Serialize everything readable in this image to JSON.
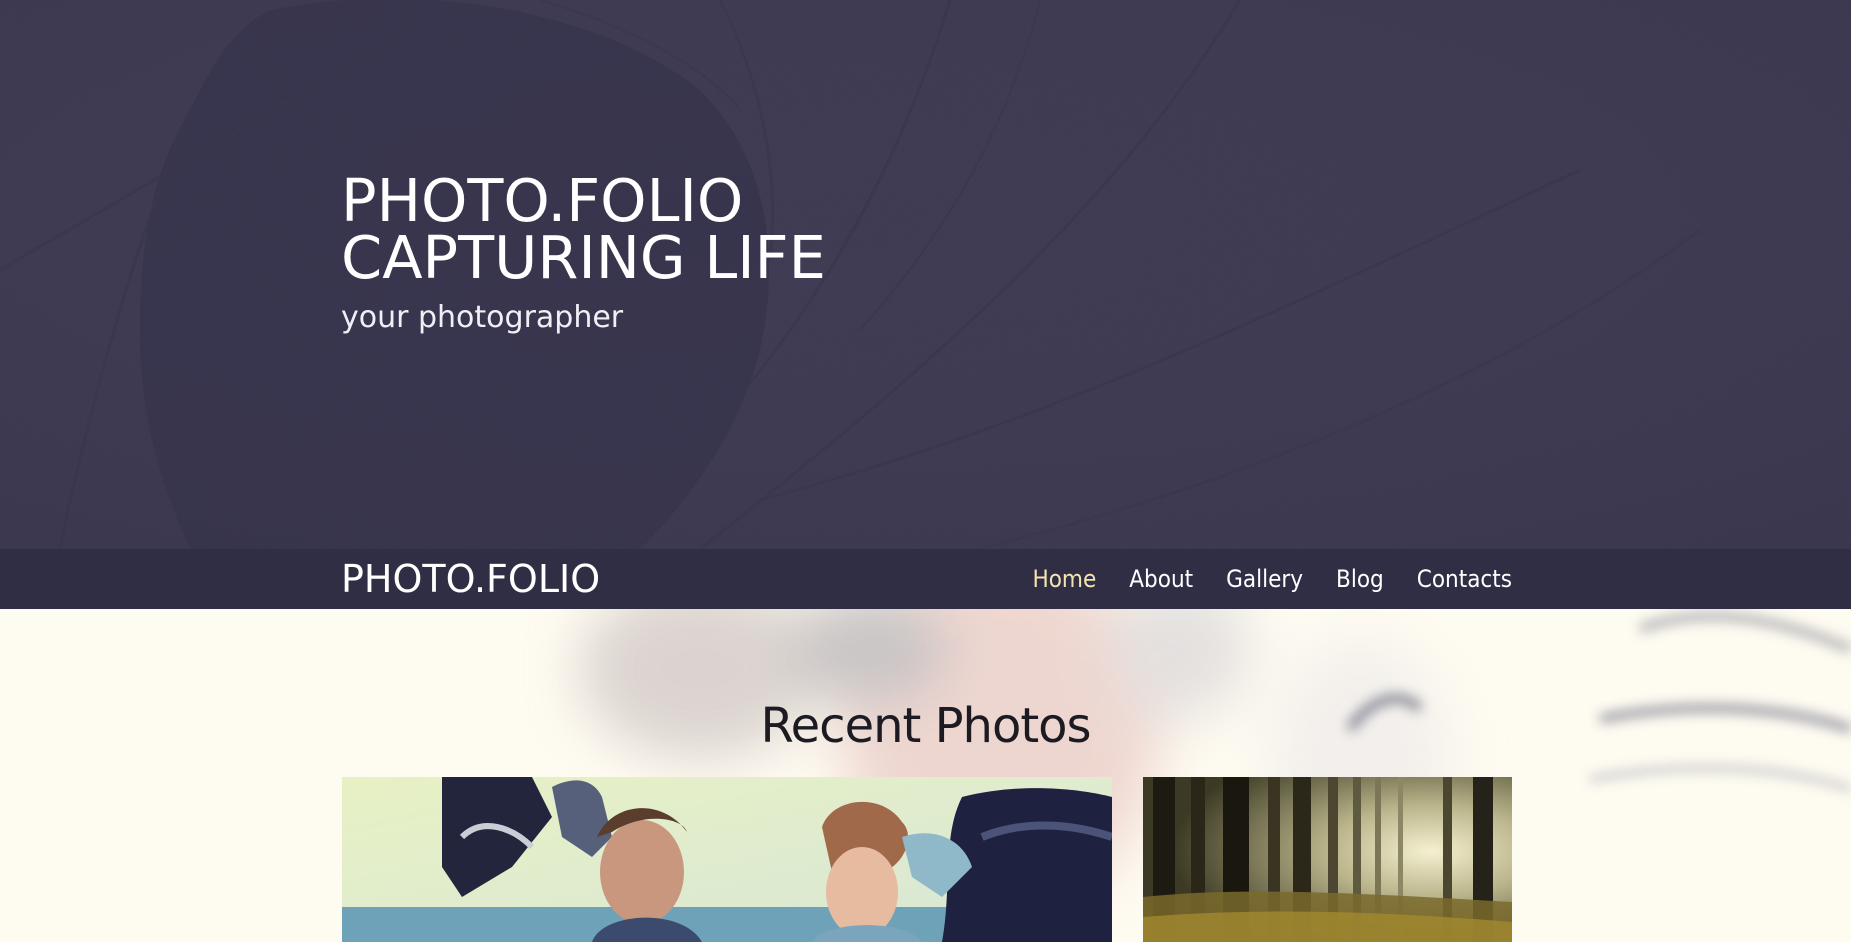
{
  "hero": {
    "title_line1": "PHOTO.FOLIO",
    "title_line2": "CAPTURING LIFE",
    "subtitle": "your photographer",
    "background_icon": "camera-aperture-icon"
  },
  "navbar": {
    "brand": "PHOTO.FOLIO",
    "links": [
      {
        "label": "Home",
        "active": true
      },
      {
        "label": "About",
        "active": false
      },
      {
        "label": "Gallery",
        "active": false
      },
      {
        "label": "Blog",
        "active": false
      },
      {
        "label": "Contacts",
        "active": false
      }
    ]
  },
  "main": {
    "section_title": "Recent Photos",
    "photos": [
      {
        "subject": "couple-motorcycle-photo"
      },
      {
        "subject": "forest-sunlight-photo"
      }
    ]
  },
  "colors": {
    "hero_bg": "#3e3b52",
    "navbar_bg": "#302e45",
    "active_link": "#f3e4b0",
    "content_bg": "#fefbf1"
  }
}
